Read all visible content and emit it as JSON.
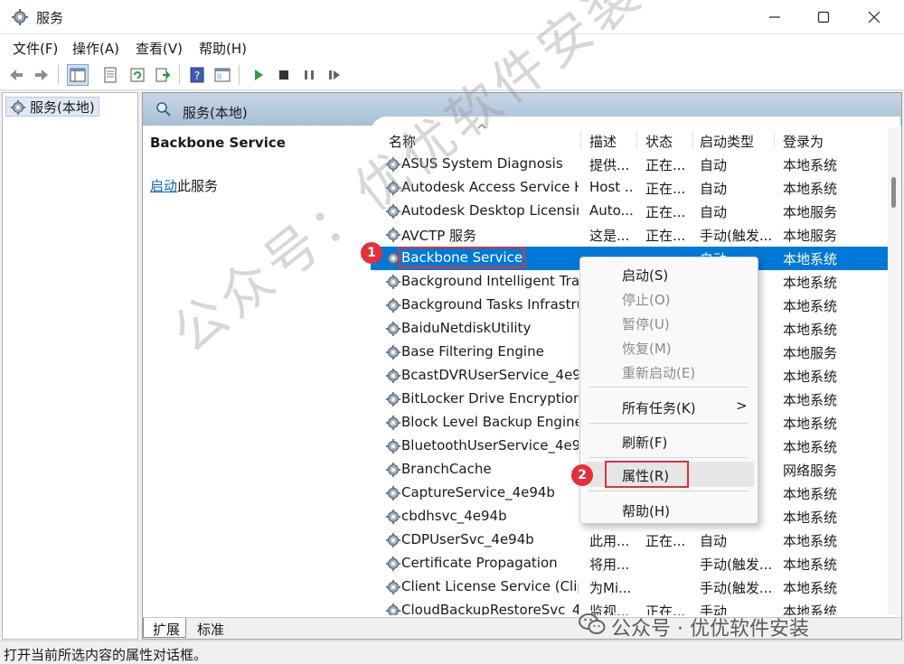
{
  "window": {
    "title": "服务"
  },
  "menu": [
    "文件(F)",
    "操作(A)",
    "查看(V)",
    "帮助(H)"
  ],
  "toolbar": {
    "icons": [
      "back-arrow-icon",
      "forward-arrow-icon",
      "show-hide-console-tree-icon",
      "properties-icon",
      "refresh-icon",
      "export-list-icon",
      "help-icon",
      "extended-view-icon",
      "play-icon",
      "stop-icon",
      "pause-icon",
      "resume-icon"
    ]
  },
  "tree": {
    "root": "服务(本地)"
  },
  "panel": {
    "header": "服务(本地)",
    "selected_service": "Backbone Service",
    "action_link": "启动",
    "action_suffix": "此服务"
  },
  "columns": {
    "name": "名称",
    "desc": "描述",
    "status": "状态",
    "startup": "启动类型",
    "logon": "登录为"
  },
  "services": [
    {
      "name": "ASUS System Diagnosis",
      "desc": "提供...",
      "status": "正在...",
      "startup": "自动",
      "logon": "本地系统"
    },
    {
      "name": "Autodesk Access Service H...",
      "desc": "Host ...",
      "status": "正在...",
      "startup": "自动",
      "logon": "本地系统"
    },
    {
      "name": "Autodesk Desktop Licensin...",
      "desc": "Auto...",
      "status": "正在...",
      "startup": "自动",
      "logon": "本地服务"
    },
    {
      "name": "AVCTP 服务",
      "desc": "这是...",
      "status": "正在...",
      "startup": "手动(触发...",
      "logon": "本地服务"
    },
    {
      "name": "Backbone Service",
      "desc": "",
      "status": "",
      "startup": "自动",
      "logon": "本地系统"
    },
    {
      "name": "Background Intelligent Tra...",
      "desc": "",
      "status": "",
      "startup": "",
      "logon": "本地系统"
    },
    {
      "name": "Background Tasks Infrastru...",
      "desc": "",
      "status": "",
      "startup": "",
      "logon": "本地系统"
    },
    {
      "name": "BaiduNetdiskUtility",
      "desc": "",
      "status": "",
      "startup": "",
      "logon": "本地系统"
    },
    {
      "name": "Base Filtering Engine",
      "desc": "",
      "status": "",
      "startup": "",
      "logon": "本地服务"
    },
    {
      "name": "BcastDVRUserService_4e9...",
      "desc": "",
      "status": "",
      "startup": "",
      "logon": "本地系统"
    },
    {
      "name": "BitLocker Drive Encryption ...",
      "desc": "",
      "status": "",
      "startup": "",
      "logon": "本地系统"
    },
    {
      "name": "Block Level Backup Engine ...",
      "desc": "",
      "status": "",
      "startup": "",
      "logon": "本地系统"
    },
    {
      "name": "BluetoothUserService_4e9...",
      "desc": "",
      "status": "",
      "startup": "",
      "logon": "本地系统"
    },
    {
      "name": "BranchCache",
      "desc": "",
      "status": "",
      "startup": "",
      "logon": "网络服务"
    },
    {
      "name": "CaptureService_4e94b",
      "desc": "",
      "status": "",
      "startup": "",
      "logon": "本地系统"
    },
    {
      "name": "cbdhsvc_4e94b",
      "desc": "",
      "status": "",
      "startup": "",
      "logon": "本地系统"
    },
    {
      "name": "CDPUserSvc_4e94b",
      "desc": "此用...",
      "status": "正在...",
      "startup": "自动",
      "logon": "本地系统"
    },
    {
      "name": "Certificate Propagation",
      "desc": "将用...",
      "status": "",
      "startup": "手动(触发...",
      "logon": "本地系统"
    },
    {
      "name": "Client License Service (Clip...",
      "desc": "为Mi...",
      "status": "",
      "startup": "手动(触发...",
      "logon": "本地系统"
    },
    {
      "name": "CloudBackupRestoreSvc_4...",
      "desc": "监视...",
      "status": "正在...",
      "startup": "手动",
      "logon": "本地系统"
    }
  ],
  "context_menu": [
    {
      "label": "启动(S)",
      "enabled": true
    },
    {
      "label": "停止(O)",
      "enabled": false
    },
    {
      "label": "暂停(U)",
      "enabled": false
    },
    {
      "label": "恢复(M)",
      "enabled": false
    },
    {
      "label": "重新启动(E)",
      "enabled": false
    },
    {
      "label": "所有任务(K)",
      "enabled": true,
      "submenu": true
    },
    {
      "label": "刷新(F)",
      "enabled": true
    },
    {
      "label": "属性(R)",
      "enabled": true,
      "hover": true
    },
    {
      "label": "帮助(H)",
      "enabled": true
    }
  ],
  "context_menu_chevron": ">",
  "tabs": [
    "扩展",
    "标准"
  ],
  "status_text": "打开当前所选内容的属性对话框。",
  "annotations": {
    "step1": "1",
    "step2": "2"
  },
  "watermark": {
    "diagonal": "公众号：优优软件安装",
    "brand": "公众号 · 优优软件安装"
  },
  "colors": {
    "selection": "#0078d7",
    "highlight_red": "#d9343a",
    "panel_header": "#b8cbe0"
  }
}
